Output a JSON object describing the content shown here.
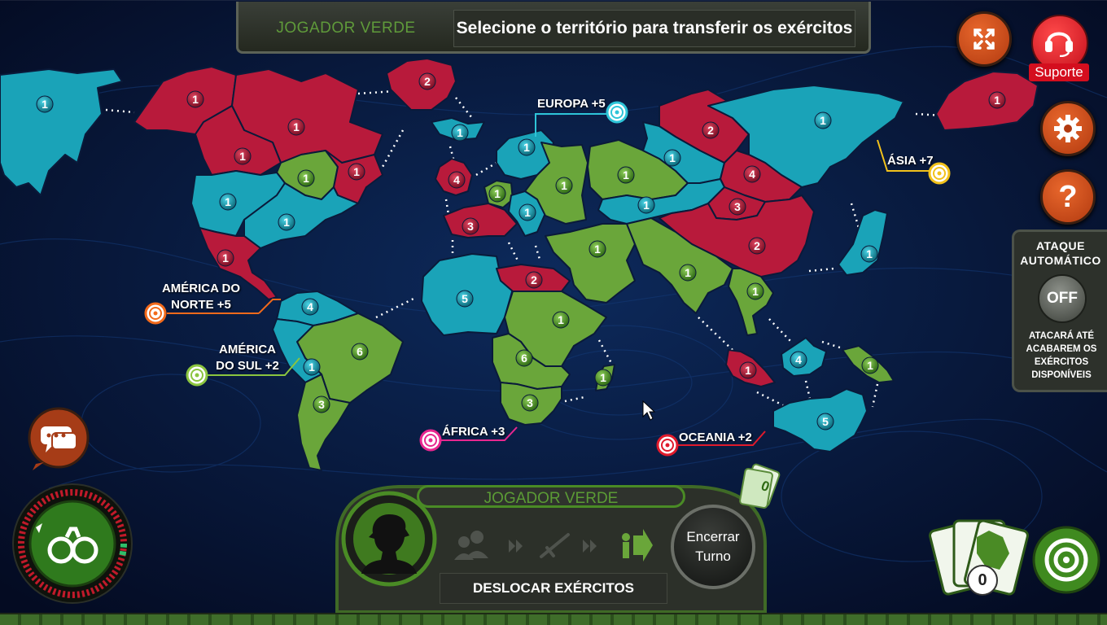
{
  "header": {
    "player_name": "JOGADOR VERDE",
    "instruction": "Selecione o território para transferir os exércitos"
  },
  "buttons": {
    "fullscreen_icon": "fullscreen-icon",
    "support_label": "Suporte",
    "settings_icon": "gear-icon",
    "help_label": "?"
  },
  "auto_attack": {
    "title_line1": "ATAQUE",
    "title_line2": "AUTOMÁTICO",
    "toggle": "OFF",
    "desc_line1": "ATACARÁ ATÉ",
    "desc_line2": "ACABAREM OS",
    "desc_line3": "EXÉRCITOS",
    "desc_line4": "DISPONÍVEIS"
  },
  "continents": {
    "north_america": {
      "line1": "AMÉRICA DO",
      "line2": "NORTE +5",
      "color": "#f26a1b"
    },
    "south_america": {
      "line1": "AMÉRICA",
      "line2": "DO SUL +2",
      "color": "#8bc53f"
    },
    "europe": {
      "label": "EUROPA +5",
      "color": "#2ec4d8"
    },
    "asia": {
      "label": "ÁSIA +7",
      "color": "#f2c21b"
    },
    "africa": {
      "label": "ÁFRICA +3",
      "color": "#e8278f"
    },
    "oceania": {
      "label": "OCEANIA +2",
      "color": "#e01a2b"
    }
  },
  "territory_colors": {
    "red": "#b81a3b",
    "blue": "#1aa3b8",
    "green": "#6aa63a"
  },
  "territories": [
    {
      "name": "alaska",
      "owner": "blue",
      "armies": "1"
    },
    {
      "name": "northwest",
      "owner": "red",
      "armies": "1"
    },
    {
      "name": "greenland",
      "owner": "red",
      "armies": "2"
    },
    {
      "name": "canada-mid",
      "owner": "red",
      "armies": "1"
    },
    {
      "name": "alberta",
      "owner": "red",
      "armies": "1"
    },
    {
      "name": "ontario",
      "owner": "green",
      "armies": "1"
    },
    {
      "name": "quebec",
      "owner": "red",
      "armies": "1"
    },
    {
      "name": "west-us",
      "owner": "blue",
      "armies": "1"
    },
    {
      "name": "east-us",
      "owner": "blue",
      "armies": "1"
    },
    {
      "name": "central-america",
      "owner": "red",
      "armies": "1"
    },
    {
      "name": "venezuela",
      "owner": "blue",
      "armies": "4"
    },
    {
      "name": "brazil",
      "owner": "green",
      "armies": "6"
    },
    {
      "name": "peru",
      "owner": "blue",
      "armies": "1"
    },
    {
      "name": "argentina",
      "owner": "green",
      "armies": "3"
    },
    {
      "name": "iceland",
      "owner": "blue",
      "armies": "1"
    },
    {
      "name": "uk",
      "owner": "red",
      "armies": "4"
    },
    {
      "name": "scandinavia",
      "owner": "blue",
      "armies": "1"
    },
    {
      "name": "north-europe",
      "owner": "green",
      "armies": "1"
    },
    {
      "name": "south-europe",
      "owner": "blue",
      "armies": "1"
    },
    {
      "name": "west-europe",
      "owner": "red",
      "armies": "3"
    },
    {
      "name": "ukraine",
      "owner": "green",
      "armies": "1"
    },
    {
      "name": "north-africa",
      "owner": "blue",
      "armies": "5"
    },
    {
      "name": "egypt",
      "owner": "red",
      "armies": "2"
    },
    {
      "name": "east-africa",
      "owner": "green",
      "armies": "1"
    },
    {
      "name": "congo",
      "owner": "green",
      "armies": "6"
    },
    {
      "name": "south-africa",
      "owner": "green",
      "armies": "3"
    },
    {
      "name": "madagascar",
      "owner": "green",
      "armies": "1"
    },
    {
      "name": "ural",
      "owner": "green",
      "armies": "1"
    },
    {
      "name": "siberia",
      "owner": "blue",
      "armies": "1"
    },
    {
      "name": "yakutsk",
      "owner": "red",
      "armies": "2"
    },
    {
      "name": "kamchatka",
      "owner": "blue",
      "armies": "1"
    },
    {
      "name": "east-kamchatka",
      "owner": "red",
      "armies": "1"
    },
    {
      "name": "irkutsk",
      "owner": "red",
      "armies": "4"
    },
    {
      "name": "afghanistan",
      "owner": "blue",
      "armies": "1"
    },
    {
      "name": "mongolia",
      "owner": "red",
      "armies": "3"
    },
    {
      "name": "china",
      "owner": "red",
      "armies": "2"
    },
    {
      "name": "japan",
      "owner": "blue",
      "armies": "1"
    },
    {
      "name": "middle-east",
      "owner": "green",
      "armies": "1"
    },
    {
      "name": "india",
      "owner": "green",
      "armies": "1"
    },
    {
      "name": "siam",
      "owner": "green",
      "armies": "1"
    },
    {
      "name": "indonesia",
      "owner": "red",
      "armies": "1"
    },
    {
      "name": "new-guinea",
      "owner": "blue",
      "armies": "4"
    },
    {
      "name": "pacific-island",
      "owner": "green",
      "armies": "1"
    },
    {
      "name": "australia",
      "owner": "blue",
      "armies": "5"
    }
  ],
  "turn_panel": {
    "player_name": "JOGADOR VERDE",
    "phase": "DESLOCAR EXÉRCITOS",
    "end_turn_line1": "Encerrar",
    "end_turn_line2": "Turno",
    "cards_bonus": "0"
  },
  "cards": {
    "count": "0"
  },
  "icons": {
    "chat": "chat-bubble-icon",
    "binoculars": "binoculars-icon",
    "target": "target-icon"
  }
}
